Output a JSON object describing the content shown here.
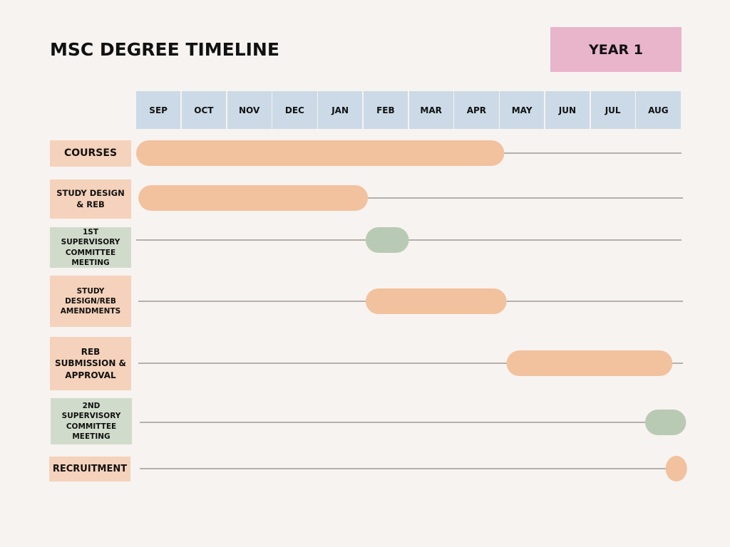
{
  "header": {
    "title": "MSC DEGREE TIMELINE",
    "year_label": "YEAR 1"
  },
  "colors": {
    "background": "#f7f3f0",
    "month_header": "#cbdae6",
    "year_badge": "#e8b5cb",
    "peach_bar": "#f2c19e",
    "peach_label": "#f5d2bb",
    "sage_bar": "#b8cab3",
    "sage_label": "#d1dbcb",
    "track_line": "#a09a96"
  },
  "chart_data": {
    "type": "gantt",
    "title": "MSC DEGREE TIMELINE",
    "subtitle": "YEAR 1",
    "months": [
      "SEP",
      "OCT",
      "NOV",
      "DEC",
      "JAN",
      "FEB",
      "MAR",
      "APR",
      "MAY",
      "JUN",
      "JUL",
      "AUG"
    ],
    "tasks": [
      {
        "label": "COURSES",
        "start": 0,
        "end": 8.1,
        "color": "peach"
      },
      {
        "label": "STUDY DESIGN & REB",
        "start": 0.05,
        "end": 5.1,
        "color": "peach"
      },
      {
        "label": "1ST SUPERVISORY COMMITTEE MEETING",
        "start": 5.05,
        "end": 6.0,
        "color": "sage"
      },
      {
        "label": "STUDY DESIGN/REB AMENDMENTS",
        "start": 5.05,
        "end": 8.15,
        "color": "peach"
      },
      {
        "label": "REB SUBMISSION & APPROVAL",
        "start": 8.15,
        "end": 11.8,
        "color": "peach"
      },
      {
        "label": "2ND SUPERVISORY COMMITTEE MEETING",
        "start": 11.2,
        "end": 12.1,
        "color": "sage"
      },
      {
        "label": "RECRUITMENT",
        "start": 11.65,
        "end": 12.1,
        "color": "peach"
      }
    ],
    "units": "months from start of September"
  }
}
